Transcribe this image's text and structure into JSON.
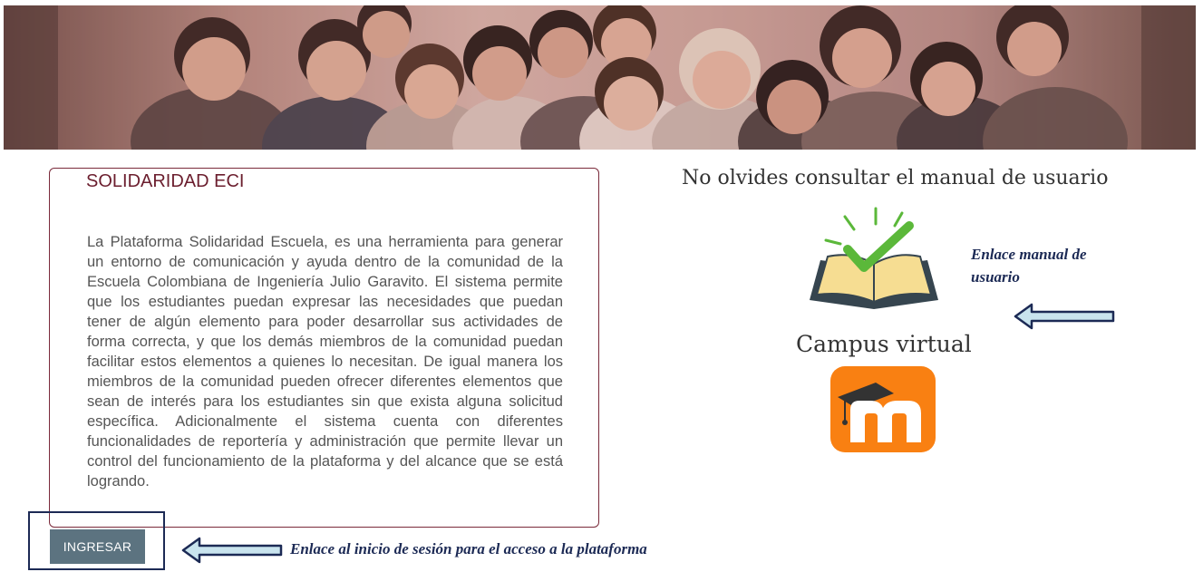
{
  "banner": {
    "alt": "Comunidad Escuela Colombiana de Ingeniería"
  },
  "info": {
    "title": "SOLIDARIDAD ECI",
    "body": "La Plataforma Solidaridad Escuela, es una herramienta para generar un entorno de comunicación y ayuda dentro de la comunidad de la Escuela Colombiana de Ingeniería Julio Garavito. El sistema permite que los estudiantes puedan expresar las necesidades que puedan tener de algún elemento para poder desarrollar sus actividades de forma correcta, y que los demás miembros de la comunidad puedan facilitar estos elementos a quienes lo necesitan. De igual manera los miembros de la comunidad pueden ofrecer diferentes elementos que sean de interés para los estudiantes sin que exista alguna solicitud específica. Adicionalmente el sistema cuenta con diferentes funcionalidades de reportería y administración que permite llevar un control del funcionamiento de la plataforma y del alcance que se está logrando."
  },
  "login": {
    "button_label": "INGRESAR"
  },
  "annotations": {
    "login_note": "Enlace al inicio de sesión para el acceso a la plataforma",
    "manual_note_line1": "Enlace manual de",
    "manual_note_line2": "usuario"
  },
  "manual": {
    "title": "No olvides consultar el manual de usuario",
    "icon": "open-book-check-icon"
  },
  "campus": {
    "title": "Campus virtual",
    "icon": "moodle-logo-icon"
  },
  "colors": {
    "box_border": "#7a2a3a",
    "title_text": "#6b1e2e",
    "button_bg": "#5c7380",
    "annotation_navy": "#1c2a55",
    "moodle_orange": "#f98012",
    "check_green": "#5bb83a"
  }
}
